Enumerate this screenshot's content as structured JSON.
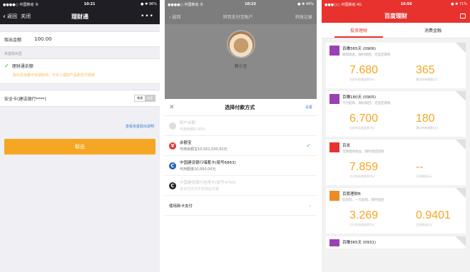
{
  "phone1": {
    "status": {
      "left": "●●●●○ 中国移动 令",
      "time": "10:21",
      "right": "● ✱ 96%"
    },
    "nav": {
      "back": "返回",
      "close": "关闭",
      "title": "理财通",
      "more": "•••"
    },
    "amount": {
      "label": "取出金额",
      "value": "100.00"
    },
    "section_label": "资金取出至",
    "option": {
      "title": "理财通余额",
      "desc": "取出至余额可快速取现，可买入理财产品和支付使用"
    },
    "card": {
      "label": "安全卡(建设银行****)",
      "toggle_left": "普通",
      "toggle_right": "快速"
    },
    "link": "查看资金取出说明",
    "button": "取出"
  },
  "phone2": {
    "status": {
      "left": "●●●●○ 中国移动 令",
      "time": "10:23",
      "right": "● ✱ 49%"
    },
    "nav": {
      "back": "返回",
      "title": "转到支付宝账户",
      "right": "转账记录"
    },
    "avatar_name": "郭小豆",
    "sheet": {
      "close": "✕",
      "title": "选择付款方式",
      "right": "设置"
    },
    "methods": [
      {
        "icon": "coin-icon",
        "a": "账户余额",
        "b": "可用余额0.00元",
        "disabled": true
      },
      {
        "icon": "yuebao-icon",
        "a": "余额宝",
        "b": "可用余额宝10,501,530.02元",
        "disabled": false,
        "selected": true
      },
      {
        "icon": "ccb-icon",
        "a": "中国建设银行储蓄卡(尾号6863)",
        "b": "可用额度10,000.00元",
        "disabled": false
      },
      {
        "icon": "ccb-icon",
        "a": "中国建设银行信用卡(尾号4750)",
        "b": "该支付方式不支持此交易",
        "disabled": true
      }
    ],
    "add_card": "使用新卡支付",
    "colors": {
      "yuebao": "#e8322d",
      "ccb": "#1f5fae",
      "check": "#3d9bf0"
    }
  },
  "phone3": {
    "status": {
      "left": "●●●○○ 中国移动 4G",
      "time": "10:56",
      "right": "● ✱ 71%"
    },
    "title": "百度理财",
    "tabs": [
      "投资理财",
      "消费金融"
    ],
    "products": [
      {
        "name": "百赚365天 (0906)",
        "tags": "随取赎金、随时赎回、无固定期限",
        "rate": "7.680",
        "days": "365",
        "cap1": "历史年化收益率(%)",
        "cap2": "建议持有期限(天)",
        "logo": "purple"
      },
      {
        "name": "百赚180天 (0905)",
        "tags": "千元起购、期间赎回、无固定期限",
        "rate": "6.700",
        "days": "180",
        "cap1": "历史年化收益率(%)",
        "cap2": "建议持有期限(天)",
        "logo": "purple"
      },
      {
        "name": "百发",
        "tags": "活期理财收益、随时赎回回款",
        "rate": "7.859",
        "days": "--",
        "cap1": "七日年化收益率(%)",
        "cap2": "万份收益(元)",
        "logo": "red"
      },
      {
        "name": "百度理财B",
        "tags": "低风险、一元起购、随时赎回",
        "rate": "3.269",
        "days": "0.9401",
        "cap1": "七日年化收益率(%)",
        "cap2": "万份收益(元)",
        "logo": "orange"
      },
      {
        "name": "百赚365天 (0931)",
        "logo": "purple"
      }
    ]
  }
}
